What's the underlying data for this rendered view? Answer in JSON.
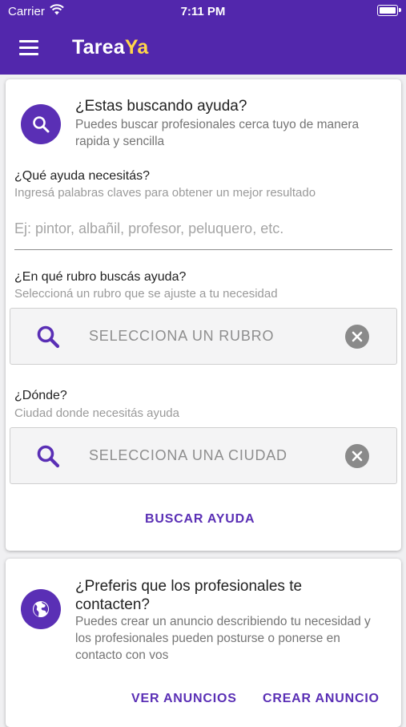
{
  "status_bar": {
    "carrier": "Carrier",
    "time": "7:11 PM"
  },
  "app_bar": {
    "brand_main": "Tarea",
    "brand_accent": "Ya",
    "menu_icon": "hamburger-menu-icon"
  },
  "search_card": {
    "icon": "search-icon",
    "title": "¿Estas buscando ayuda?",
    "description": "Puedes buscar profesionales cerca tuyo de manera rapida y sencilla",
    "need": {
      "label": "¿Qué ayuda necesitás?",
      "hint": "Ingresá palabras claves para  obtener un mejor resultado",
      "placeholder": "Ej: pintor, albañil, profesor, peluquero, etc.",
      "value": ""
    },
    "category": {
      "label": "¿En qué rubro buscás ayuda?",
      "hint": "Seleccioná un rubro que se ajuste a tu necesidad",
      "placeholder": "SELECCIONA UN RUBRO"
    },
    "location": {
      "label": "¿Dónde?",
      "hint": "Ciudad donde necesitás ayuda",
      "placeholder": "SELECCIONA UNA CIUDAD"
    },
    "search_button": "BUSCAR AYUDA"
  },
  "ad_card": {
    "icon": "globe-icon",
    "title": "¿Preferis que los profesionales te contacten?",
    "description": "Puedes crear un anuncio describiendo tu necesidad y los profesionales pueden posturse o ponerse en contacto con vos",
    "view_button": "VER ANUNCIOS",
    "create_button": "CREAR ANUNCIO"
  },
  "colors": {
    "primary": "#5227ac",
    "accent": "#ffd54a"
  }
}
